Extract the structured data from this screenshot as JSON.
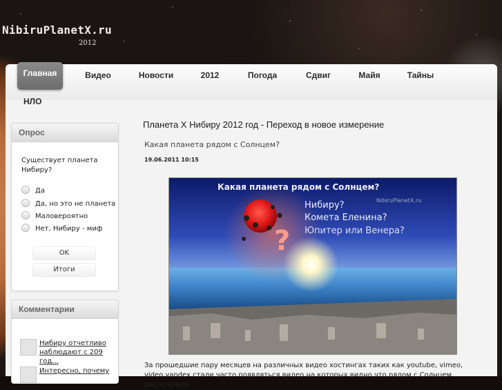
{
  "header": {
    "logo": "NibiruPlanetX.ru",
    "year": "2012"
  },
  "nav": {
    "items": [
      {
        "label": "Главная",
        "active": true
      },
      {
        "label": "Видео"
      },
      {
        "label": "Новости"
      },
      {
        "label": "2012"
      },
      {
        "label": "Погода"
      },
      {
        "label": "Сдвиг"
      },
      {
        "label": "Майя"
      },
      {
        "label": "Тайны"
      },
      {
        "label": "НЛО"
      }
    ]
  },
  "poll": {
    "title": "Опрос",
    "question": "Существует планета Нибиру?",
    "options": [
      "Да",
      "Да, но это не планета",
      "Маловероятно",
      "Нет, Нибиру - миф"
    ],
    "ok_label": "OK",
    "results_label": "Итоги"
  },
  "comments": {
    "title": "Комментарии",
    "items": [
      {
        "text": "Нибиру отчетливо наблюдают с 209 год..."
      },
      {
        "text": "Интересно, почему"
      }
    ]
  },
  "article": {
    "title": "Планета Х Нибиру 2012 год - Переход в новое измерение",
    "subtitle": "Какая планета рядом с Солнцем?",
    "date": "19.06.2011 10:15",
    "image": {
      "line1": "Какая планета рядом с Солнцем?",
      "line2": "Нибиру?",
      "line3": "Комета Еленина?",
      "line4": "Юпитер или Венера?",
      "watermark": "NibiruPlanetX.ru",
      "question_mark": "?"
    },
    "body_line1": "За прошедшие пару месяцев на различных видео хостингах таких как youtube, vimeo,",
    "body_line2": "video.yandex стали часто появляться видео на которых видно что рядом с Солнцем расположен"
  },
  "colors": {
    "nav_active": "#7a7a7a",
    "page_bg": "#f3f3f3"
  }
}
